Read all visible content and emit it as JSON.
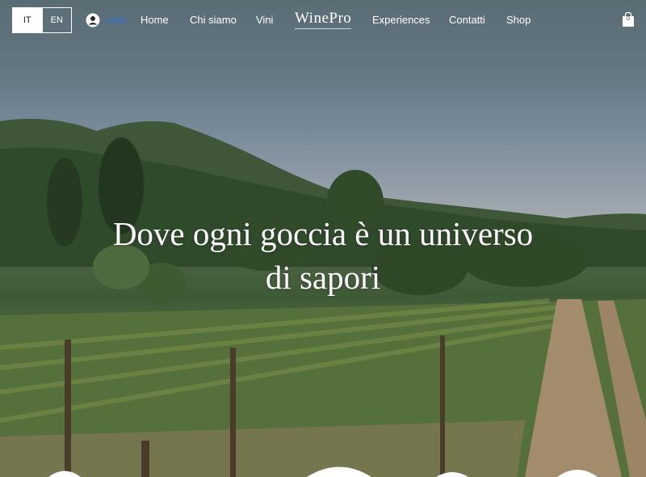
{
  "language_switcher": {
    "it_label": "IT",
    "en_label": "EN",
    "selected": "IT"
  },
  "login": {
    "label": "Login",
    "icon": "user-circle-icon"
  },
  "nav": {
    "items": [
      {
        "label": "Home"
      },
      {
        "label": "Chi siamo"
      },
      {
        "label": "Vini"
      },
      {
        "label": "Experiences"
      },
      {
        "label": "Contatti"
      },
      {
        "label": "Shop"
      }
    ],
    "brand": "WinePro"
  },
  "cart": {
    "count": "0",
    "icon": "shopping-bag-icon"
  },
  "hero": {
    "headline_line1": "Dove ogni goccia è un universo",
    "headline_line2": "di sapori",
    "image": "vineyard-landscape"
  },
  "colors": {
    "accent": "#2f6fdc",
    "text_light": "#ffffff"
  }
}
